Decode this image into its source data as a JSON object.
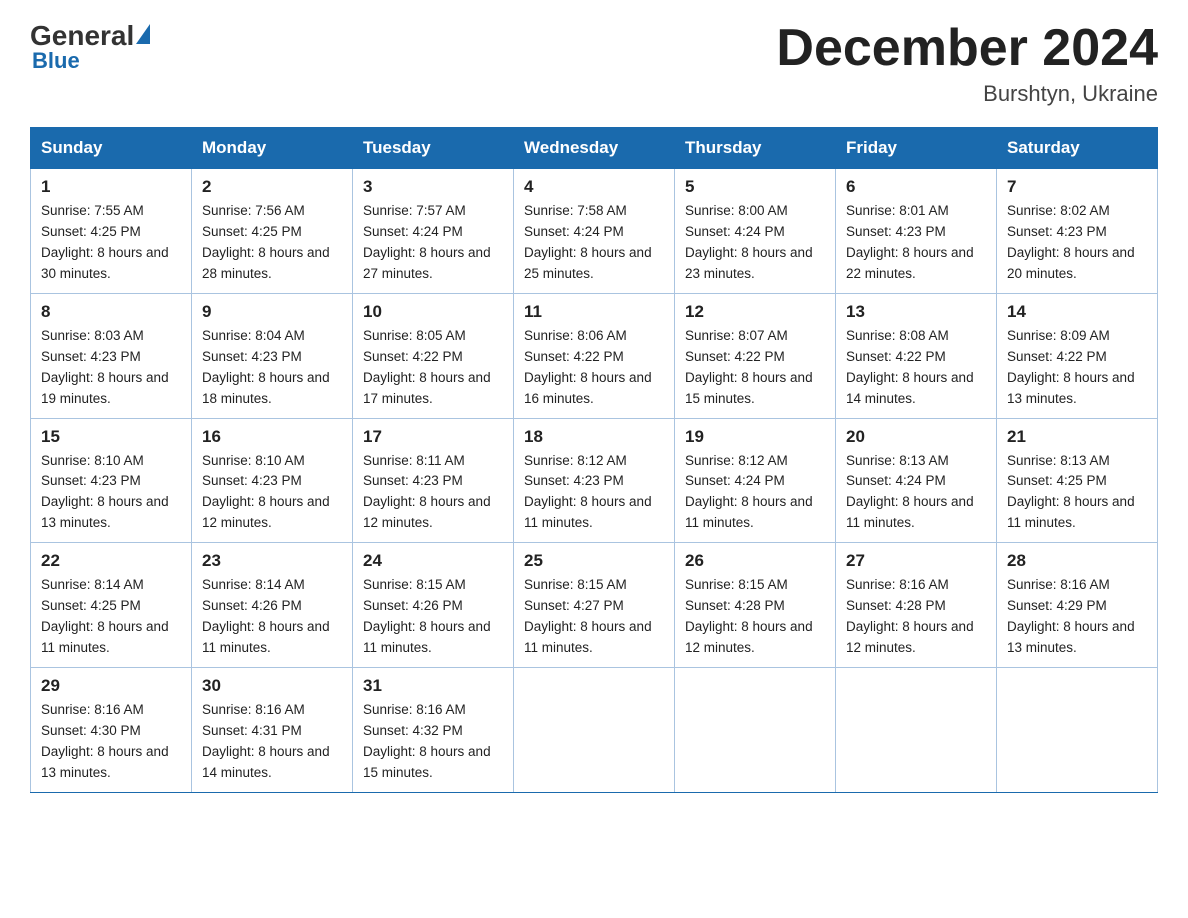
{
  "header": {
    "logo": {
      "general": "General",
      "blue": "Blue"
    },
    "title": "December 2024",
    "location": "Burshtyn, Ukraine"
  },
  "days_of_week": [
    "Sunday",
    "Monday",
    "Tuesday",
    "Wednesday",
    "Thursday",
    "Friday",
    "Saturday"
  ],
  "weeks": [
    [
      {
        "day": "1",
        "sunrise": "7:55 AM",
        "sunset": "4:25 PM",
        "daylight": "8 hours and 30 minutes."
      },
      {
        "day": "2",
        "sunrise": "7:56 AM",
        "sunset": "4:25 PM",
        "daylight": "8 hours and 28 minutes."
      },
      {
        "day": "3",
        "sunrise": "7:57 AM",
        "sunset": "4:24 PM",
        "daylight": "8 hours and 27 minutes."
      },
      {
        "day": "4",
        "sunrise": "7:58 AM",
        "sunset": "4:24 PM",
        "daylight": "8 hours and 25 minutes."
      },
      {
        "day": "5",
        "sunrise": "8:00 AM",
        "sunset": "4:24 PM",
        "daylight": "8 hours and 23 minutes."
      },
      {
        "day": "6",
        "sunrise": "8:01 AM",
        "sunset": "4:23 PM",
        "daylight": "8 hours and 22 minutes."
      },
      {
        "day": "7",
        "sunrise": "8:02 AM",
        "sunset": "4:23 PM",
        "daylight": "8 hours and 20 minutes."
      }
    ],
    [
      {
        "day": "8",
        "sunrise": "8:03 AM",
        "sunset": "4:23 PM",
        "daylight": "8 hours and 19 minutes."
      },
      {
        "day": "9",
        "sunrise": "8:04 AM",
        "sunset": "4:23 PM",
        "daylight": "8 hours and 18 minutes."
      },
      {
        "day": "10",
        "sunrise": "8:05 AM",
        "sunset": "4:22 PM",
        "daylight": "8 hours and 17 minutes."
      },
      {
        "day": "11",
        "sunrise": "8:06 AM",
        "sunset": "4:22 PM",
        "daylight": "8 hours and 16 minutes."
      },
      {
        "day": "12",
        "sunrise": "8:07 AM",
        "sunset": "4:22 PM",
        "daylight": "8 hours and 15 minutes."
      },
      {
        "day": "13",
        "sunrise": "8:08 AM",
        "sunset": "4:22 PM",
        "daylight": "8 hours and 14 minutes."
      },
      {
        "day": "14",
        "sunrise": "8:09 AM",
        "sunset": "4:22 PM",
        "daylight": "8 hours and 13 minutes."
      }
    ],
    [
      {
        "day": "15",
        "sunrise": "8:10 AM",
        "sunset": "4:23 PM",
        "daylight": "8 hours and 13 minutes."
      },
      {
        "day": "16",
        "sunrise": "8:10 AM",
        "sunset": "4:23 PM",
        "daylight": "8 hours and 12 minutes."
      },
      {
        "day": "17",
        "sunrise": "8:11 AM",
        "sunset": "4:23 PM",
        "daylight": "8 hours and 12 minutes."
      },
      {
        "day": "18",
        "sunrise": "8:12 AM",
        "sunset": "4:23 PM",
        "daylight": "8 hours and 11 minutes."
      },
      {
        "day": "19",
        "sunrise": "8:12 AM",
        "sunset": "4:24 PM",
        "daylight": "8 hours and 11 minutes."
      },
      {
        "day": "20",
        "sunrise": "8:13 AM",
        "sunset": "4:24 PM",
        "daylight": "8 hours and 11 minutes."
      },
      {
        "day": "21",
        "sunrise": "8:13 AM",
        "sunset": "4:25 PM",
        "daylight": "8 hours and 11 minutes."
      }
    ],
    [
      {
        "day": "22",
        "sunrise": "8:14 AM",
        "sunset": "4:25 PM",
        "daylight": "8 hours and 11 minutes."
      },
      {
        "day": "23",
        "sunrise": "8:14 AM",
        "sunset": "4:26 PM",
        "daylight": "8 hours and 11 minutes."
      },
      {
        "day": "24",
        "sunrise": "8:15 AM",
        "sunset": "4:26 PM",
        "daylight": "8 hours and 11 minutes."
      },
      {
        "day": "25",
        "sunrise": "8:15 AM",
        "sunset": "4:27 PM",
        "daylight": "8 hours and 11 minutes."
      },
      {
        "day": "26",
        "sunrise": "8:15 AM",
        "sunset": "4:28 PM",
        "daylight": "8 hours and 12 minutes."
      },
      {
        "day": "27",
        "sunrise": "8:16 AM",
        "sunset": "4:28 PM",
        "daylight": "8 hours and 12 minutes."
      },
      {
        "day": "28",
        "sunrise": "8:16 AM",
        "sunset": "4:29 PM",
        "daylight": "8 hours and 13 minutes."
      }
    ],
    [
      {
        "day": "29",
        "sunrise": "8:16 AM",
        "sunset": "4:30 PM",
        "daylight": "8 hours and 13 minutes."
      },
      {
        "day": "30",
        "sunrise": "8:16 AM",
        "sunset": "4:31 PM",
        "daylight": "8 hours and 14 minutes."
      },
      {
        "day": "31",
        "sunrise": "8:16 AM",
        "sunset": "4:32 PM",
        "daylight": "8 hours and 15 minutes."
      },
      null,
      null,
      null,
      null
    ]
  ]
}
